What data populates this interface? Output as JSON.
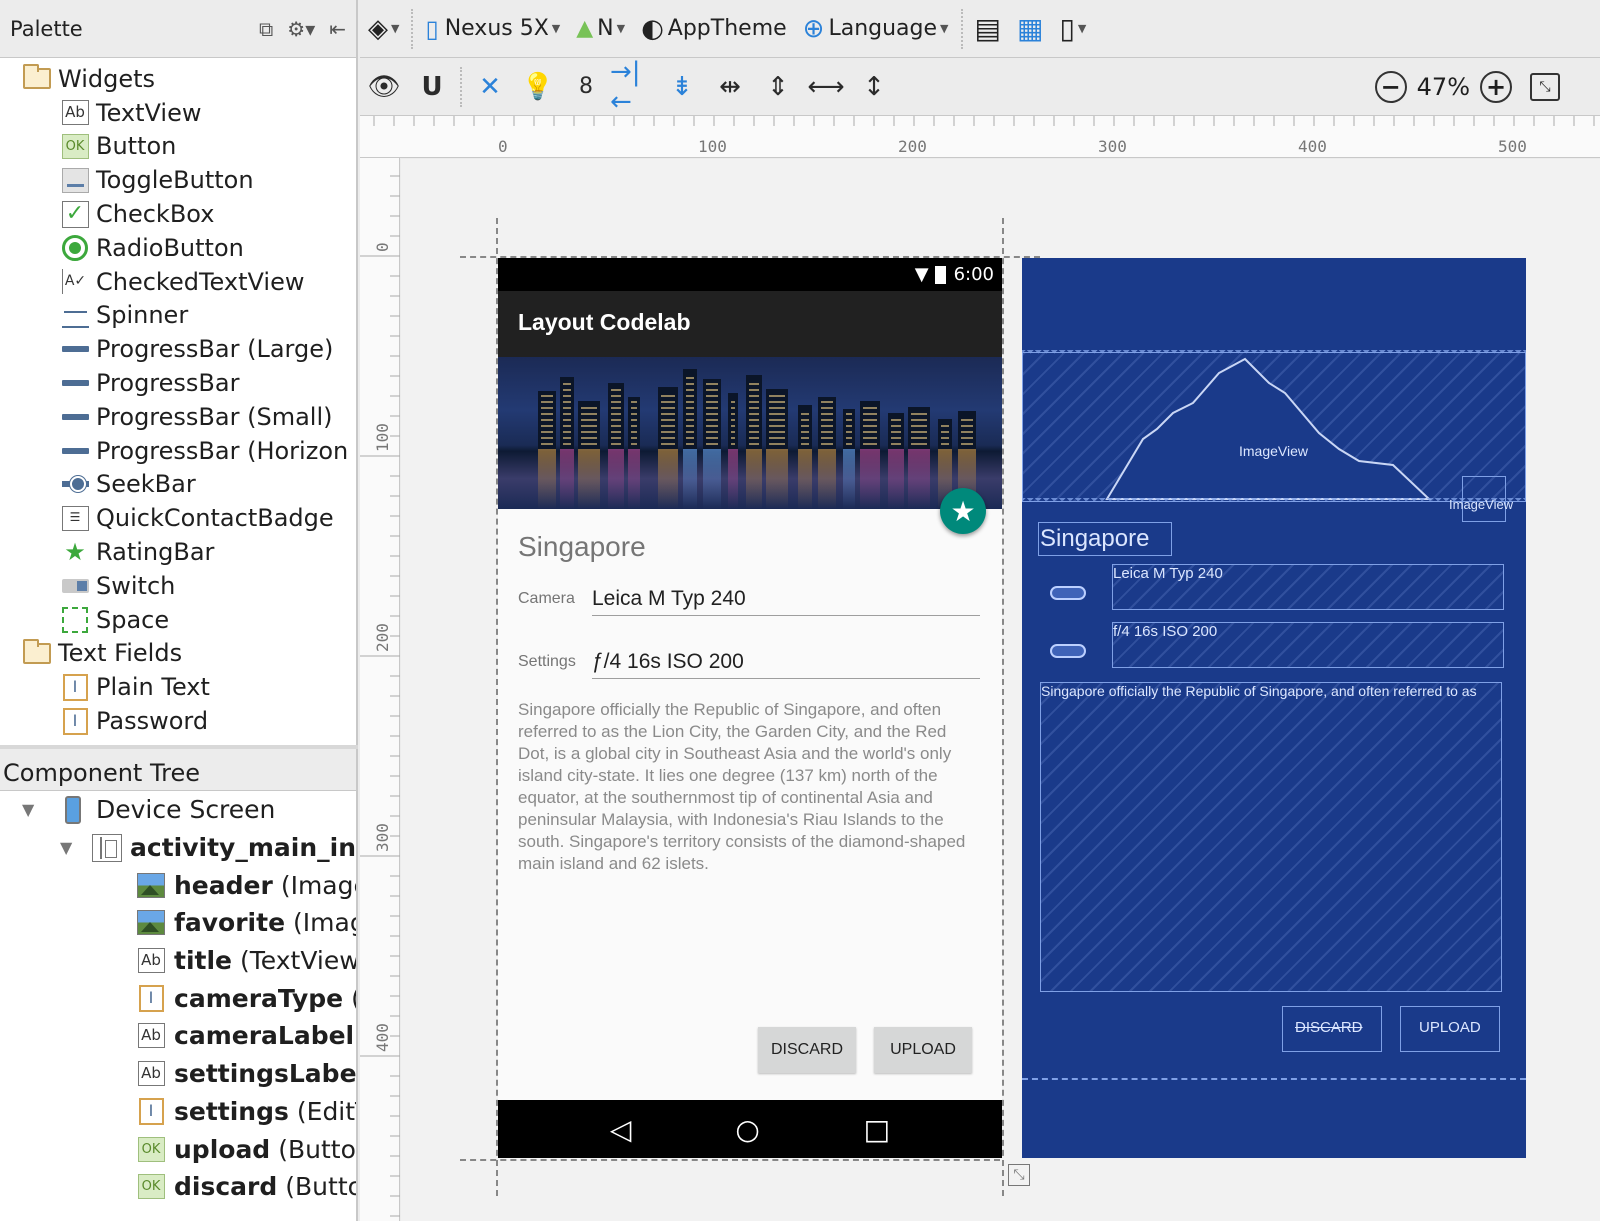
{
  "palette": {
    "title": "Palette",
    "items": [
      {
        "label": "Widgets",
        "kind": "category",
        "icon": "folder-icon"
      },
      {
        "label": "TextView",
        "kind": "item",
        "icon": "textview-icon"
      },
      {
        "label": "Button",
        "kind": "item",
        "icon": "button-icon"
      },
      {
        "label": "ToggleButton",
        "kind": "item",
        "icon": "toggle-icon"
      },
      {
        "label": "CheckBox",
        "kind": "item",
        "icon": "checkbox-icon"
      },
      {
        "label": "RadioButton",
        "kind": "item",
        "icon": "radio-icon"
      },
      {
        "label": "CheckedTextView",
        "kind": "item",
        "icon": "checkedtextview-icon"
      },
      {
        "label": "Spinner",
        "kind": "item",
        "icon": "spinner-icon"
      },
      {
        "label": "ProgressBar (Large)",
        "kind": "item",
        "icon": "progressbar-icon"
      },
      {
        "label": "ProgressBar",
        "kind": "item",
        "icon": "progressbar-icon"
      },
      {
        "label": "ProgressBar (Small)",
        "kind": "item",
        "icon": "progressbar-icon"
      },
      {
        "label": "ProgressBar (Horizon",
        "kind": "item",
        "icon": "progressbar-icon"
      },
      {
        "label": "SeekBar",
        "kind": "item",
        "icon": "seekbar-icon"
      },
      {
        "label": "QuickContactBadge",
        "kind": "item",
        "icon": "contact-badge-icon"
      },
      {
        "label": "RatingBar",
        "kind": "item",
        "icon": "star-icon"
      },
      {
        "label": "Switch",
        "kind": "item",
        "icon": "switch-icon"
      },
      {
        "label": "Space",
        "kind": "item",
        "icon": "space-icon"
      },
      {
        "label": "Text Fields",
        "kind": "category",
        "icon": "folder-icon"
      },
      {
        "label": "Plain Text",
        "kind": "item",
        "icon": "edittext-icon"
      },
      {
        "label": "Password",
        "kind": "item",
        "icon": "edittext-icon"
      }
    ]
  },
  "component_tree": {
    "title": "Component Tree",
    "rows": [
      {
        "name": "Device Screen",
        "type": "",
        "icon": "device-icon",
        "level": 0,
        "bold": false
      },
      {
        "name": "activity_main_in",
        "type": "",
        "icon": "layout-icon",
        "level": 1,
        "bold": true
      },
      {
        "name": "header",
        "type": "(Image",
        "icon": "image-icon",
        "level": 2,
        "bold": true
      },
      {
        "name": "favorite",
        "type": "(Imag",
        "icon": "image-icon",
        "level": 2,
        "bold": true
      },
      {
        "name": "title",
        "type": "(TextView",
        "icon": "textview-icon",
        "level": 2,
        "bold": true
      },
      {
        "name": "cameraType",
        "type": "(",
        "icon": "edittext-icon",
        "level": 2,
        "bold": true
      },
      {
        "name": "cameraLabel",
        "type": "",
        "icon": "textview-icon",
        "level": 2,
        "bold": true
      },
      {
        "name": "settingsLabel",
        "type": "",
        "icon": "textview-icon",
        "level": 2,
        "bold": true
      },
      {
        "name": "settings",
        "type": "(EditT",
        "icon": "edittext-icon",
        "level": 2,
        "bold": true
      },
      {
        "name": "upload",
        "type": "(Button",
        "icon": "button-icon",
        "level": 2,
        "bold": true
      },
      {
        "name": "discard",
        "type": "(Butto",
        "icon": "button-icon",
        "level": 2,
        "bold": true
      }
    ]
  },
  "toolbar": {
    "device": "Nexus 5X",
    "api": "N",
    "theme": "AppTheme",
    "language": "Language",
    "spacing_value": "8",
    "zoom": "47%"
  },
  "rulers": {
    "top_labels": [
      "0",
      "100",
      "200",
      "300",
      "400",
      "500"
    ],
    "left_labels": [
      "0",
      "100",
      "200",
      "300",
      "400"
    ]
  },
  "phone": {
    "time": "6:00",
    "app_title": "Layout Codelab",
    "city_title": "Singapore",
    "camera_label": "Camera",
    "camera_value": "Leica M Typ 240",
    "settings_label": "Settings",
    "settings_value": "ƒ/4 16s ISO 200",
    "description": "Singapore officially the Republic of Singapore, and often referred to as the Lion City, the Garden City, and the Red Dot, is a global city in Southeast Asia and the world's only island city-state. It lies one degree (137 km) north of the equator, at the southernmost tip of continental Asia and peninsular Malaysia, with Indonesia's Riau Islands to the south. Singapore's territory consists of the diamond-shaped main island and 62 islets.",
    "discard_label": "DISCARD",
    "upload_label": "UPLOAD"
  },
  "blueprint": {
    "imageview_label": "ImageView",
    "small_imageview_label": "ImageView",
    "title": "Singapore",
    "camera_value": "Leica M Typ 240",
    "settings_value": "f/4 16s ISO 200",
    "description": "Singapore officially the Republic of Singapore, and often referred to as",
    "discard_label": "DISCARD",
    "upload_label": "UPLOAD",
    "background_color": "#1a3a8a"
  },
  "colors": {
    "accent_fab": "#00897b",
    "appbar": "#212121",
    "blue_icon": "#2b82d9",
    "green_icon": "#3ca83c"
  }
}
